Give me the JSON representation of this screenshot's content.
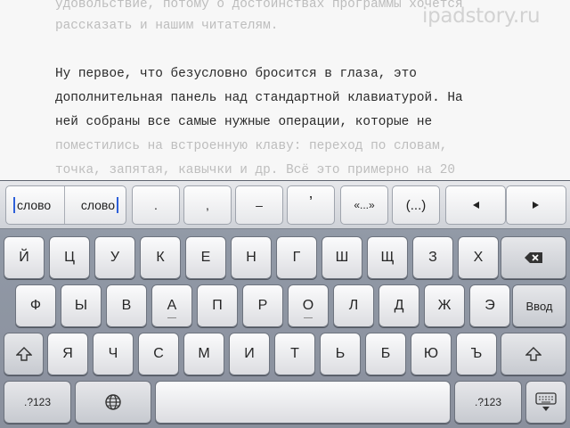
{
  "document": {
    "lines": [
      {
        "text": "удовольствие, потому о достоинствах программы хочется",
        "tone": "faded"
      },
      {
        "text": "рассказать и нашим читателям.",
        "tone": "faded"
      },
      {
        "text": "Ну первое, что безусловно бросится в глаза, это",
        "tone": "dark"
      },
      {
        "text": "дополнительная панель над стандартной клавиатурой. На",
        "tone": "dark"
      },
      {
        "text": "ней собраны все самые нужные операции, которые не",
        "tone": "dark"
      },
      {
        "text": "поместились на встроенную клаву: переход по словам,",
        "tone": "faded"
      },
      {
        "text": "точка, запятая, кавычки и др. Всё это примерно на 20",
        "tone": "faded"
      }
    ]
  },
  "watermark": {
    "text": "ipadstory.ru"
  },
  "toolbar": {
    "word_left": "слово",
    "word_right": "слово",
    "period": ".",
    "comma": ",",
    "dash": "–",
    "apostrophe": "’",
    "quotes": "«...»",
    "parens": "(...)"
  },
  "keyboard": {
    "row1": [
      "Й",
      "Ц",
      "У",
      "К",
      "Е",
      "Н",
      "Г",
      "Ш",
      "Щ",
      "З",
      "Х"
    ],
    "row2": [
      "Ф",
      "Ы",
      "В",
      "А",
      "П",
      "Р",
      "О",
      "Л",
      "Д",
      "Ж",
      "Э"
    ],
    "row3": [
      "Я",
      "Ч",
      "С",
      "М",
      "И",
      "Т",
      "Ь",
      "Б",
      "Ю",
      "Ъ"
    ],
    "enter_label": "Ввод",
    "numbers_label": ".?123"
  }
}
